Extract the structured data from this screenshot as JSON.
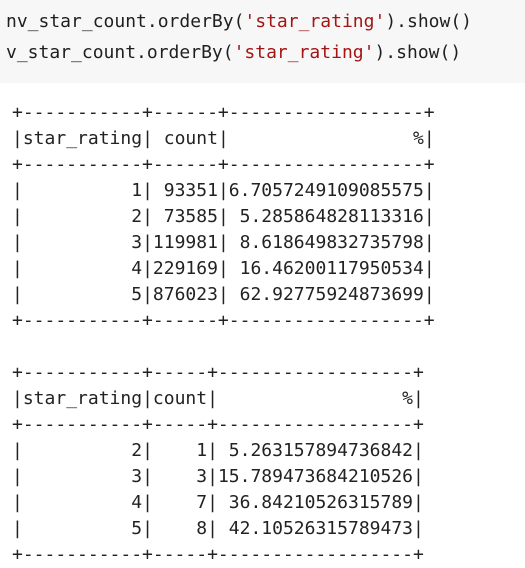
{
  "code": {
    "lines": [
      {
        "prefix": "nv_star_count.orderBy(",
        "arg": "'star_rating'",
        "suffix": ").show()"
      },
      {
        "prefix": "v_star_count.orderBy(",
        "arg": "'star_rating'",
        "suffix": ").show()"
      }
    ]
  },
  "tables": [
    {
      "header": [
        "star_rating",
        "count",
        "%"
      ],
      "rows": [
        [
          "1",
          "93351",
          "6.7057249109085575"
        ],
        [
          "2",
          "73585",
          "5.285864828113316"
        ],
        [
          "3",
          "119981",
          "8.618649832735798"
        ],
        [
          "4",
          "229169",
          "16.46200117950534"
        ],
        [
          "5",
          "876023",
          "62.92775924873699"
        ]
      ]
    },
    {
      "header": [
        "star_rating",
        "count",
        "%"
      ],
      "rows": [
        [
          "2",
          "1",
          "5.263157894736842"
        ],
        [
          "3",
          "3",
          "15.789473684210526"
        ],
        [
          "4",
          "7",
          "36.84210526315789"
        ],
        [
          "5",
          "8",
          "42.10526315789473"
        ]
      ]
    }
  ],
  "colors": {
    "code_background": "#f7f7f7",
    "string_literal": "#a31515",
    "text": "#222222"
  }
}
